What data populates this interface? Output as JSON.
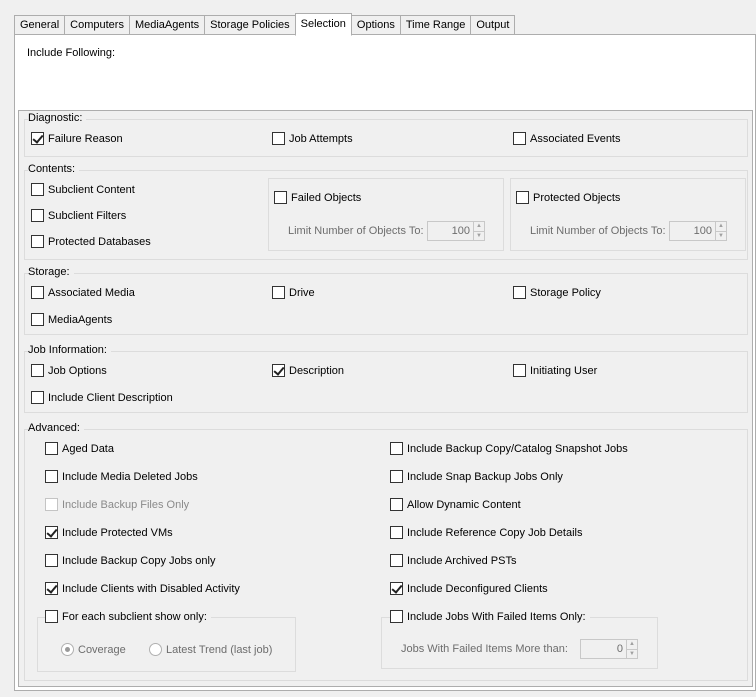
{
  "tabs": [
    "General",
    "Computers",
    "MediaAgents",
    "Storage Policies",
    "Selection",
    "Options",
    "Time Range",
    "Output"
  ],
  "active_tab": "Selection",
  "include_following_label": "Include Following:",
  "diagnostic": {
    "title": "Diagnostic:",
    "failure_reason": "Failure Reason",
    "job_attempts": "Job Attempts",
    "associated_events": "Associated Events"
  },
  "contents": {
    "title": "Contents:",
    "subclient_content": "Subclient Content",
    "subclient_filters": "Subclient Filters",
    "protected_databases": "Protected Databases",
    "failed_objects": "Failed Objects",
    "failed_limit_label": "Limit Number of Objects To:",
    "failed_limit_value": "100",
    "protected_objects": "Protected Objects",
    "protected_limit_label": "Limit Number of Objects To:",
    "protected_limit_value": "100"
  },
  "storage": {
    "title": "Storage:",
    "associated_media": "Associated Media",
    "drive": "Drive",
    "storage_policy": "Storage Policy",
    "mediaagents": "MediaAgents"
  },
  "job_information": {
    "title": "Job Information:",
    "job_options": "Job Options",
    "description": "Description",
    "initiating_user": "Initiating User",
    "include_client_description": "Include Client Description"
  },
  "advanced": {
    "title": "Advanced:",
    "aged_data": "Aged Data",
    "include_media_deleted_jobs": "Include Media Deleted Jobs",
    "include_backup_files_only": "Include Backup Files Only",
    "include_protected_vms": "Include Protected VMs",
    "include_backup_copy_jobs_only": "Include Backup Copy Jobs only",
    "include_clients_disabled_activity": "Include Clients with Disabled Activity",
    "for_each_subclient": "For each subclient show only:",
    "coverage": "Coverage",
    "latest_trend": "Latest Trend (last job)",
    "include_backup_copy_catalog": "Include Backup Copy/Catalog Snapshot Jobs",
    "include_snap_backup_jobs_only": "Include Snap Backup Jobs Only",
    "allow_dynamic_content": "Allow Dynamic Content",
    "include_reference_copy": "Include Reference Copy Job Details",
    "include_archived_psts": "Include Archived PSTs",
    "include_deconfigured_clients": "Include Deconfigured Clients",
    "include_jobs_failed_items": "Include Jobs With Failed Items Only:",
    "failed_items_more_than_label": "Jobs With Failed Items More than:",
    "failed_items_more_than_value": "0"
  }
}
